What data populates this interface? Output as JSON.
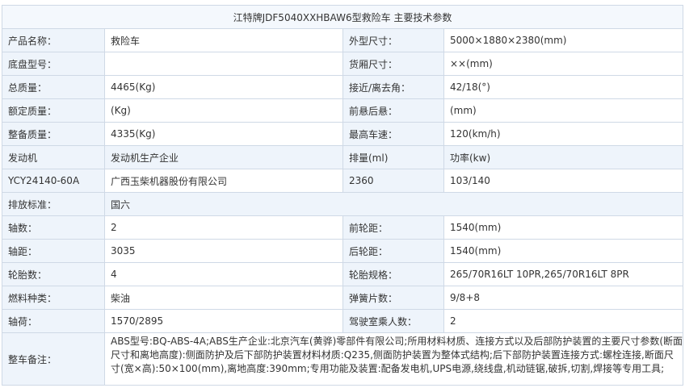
{
  "title": "江特牌JDF5040XXHBAW6型救险车 主要技术参数",
  "rows": [
    [
      "产品名称：",
      "救险车",
      "外型尺寸：",
      "5000×1880×2380(mm)"
    ],
    [
      "底盘型号：",
      "",
      "货厢尺寸：",
      "××(mm)"
    ],
    [
      "总质量：",
      "4465(Kg)",
      "接近/离去角：",
      "42/18(°)"
    ],
    [
      "额定质量：",
      "(Kg)",
      "前悬后悬：",
      "(mm)"
    ],
    [
      "整备质量：",
      "4335(Kg)",
      "最高车速：",
      "120(km/h)"
    ],
    [
      "发动机",
      "发动机生产企业",
      "排量(ml)",
      "功率(kw)"
    ],
    [
      "YCY24140-60A",
      "广西玉柴机器股份有限公司",
      "2360",
      "103/140"
    ],
    [
      "排放标准：",
      "国六"
    ],
    [
      "轴数：",
      "2",
      "前轮距：",
      "1540(mm)"
    ],
    [
      "轴距：",
      "3035",
      "后轮距：",
      "1540(mm)"
    ],
    [
      "轮胎数：",
      "4",
      "轮胎规格：",
      "265/70R16LT 10PR,265/70R16LT 8PR"
    ],
    [
      "燃料种类：",
      "柴油",
      "弹簧片数：",
      "9/8+8"
    ],
    [
      "轴荷：",
      "1570/2895",
      "驾驶室乘人数：",
      "2"
    ]
  ],
  "notes": {
    "label": "整车备注：",
    "text": "ABS型号:BQ-ABS-4A;ABS生产企业:北京汽车(黄骅)零部件有限公司;所用材料材质、连接方式以及后部防护装置的主要尺寸参数(断面尺寸和离地高度):侧面防护及后下部防护装置材料材质:Q235,侧面防护装置为整体式结构;后下部防护装置连接方式:螺栓连接,断面尺寸(宽×高):50×100(mm),离地高度:390mm;专用功能及装置:配备发电机,UPS电源,绕线盘,机动链锯,破拆,切割,焊接等专用工具;"
  }
}
